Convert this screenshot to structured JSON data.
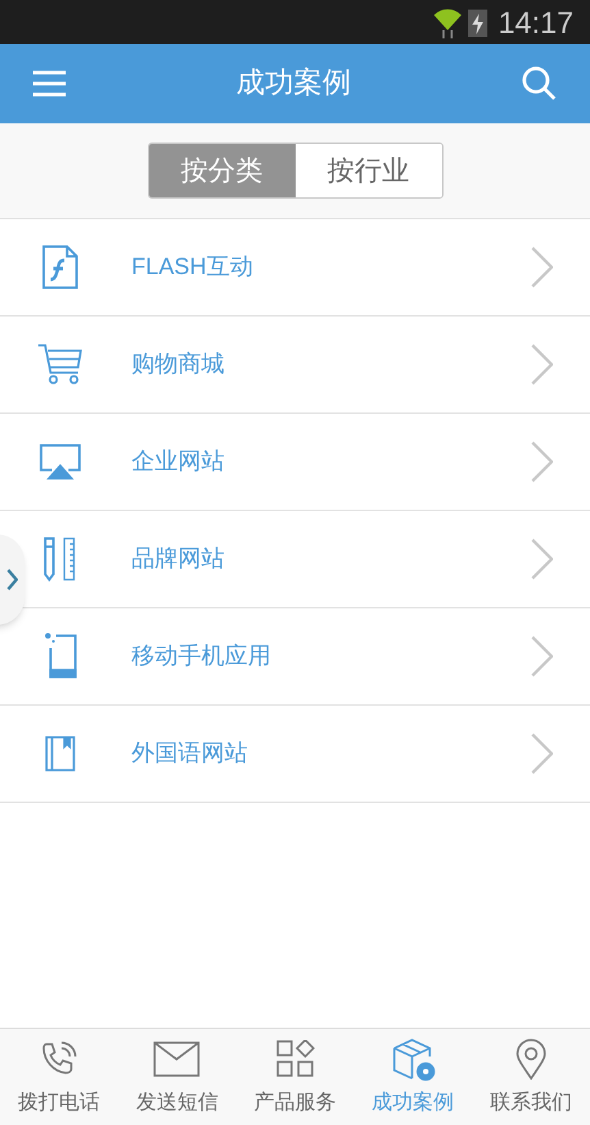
{
  "status_bar": {
    "time": "14:17"
  },
  "header": {
    "title": "成功案例"
  },
  "segments": [
    {
      "label": "按分类",
      "selected": true
    },
    {
      "label": "按行业",
      "selected": false
    }
  ],
  "categories": [
    {
      "label": "FLASH互动"
    },
    {
      "label": "购物商城"
    },
    {
      "label": "企业网站"
    },
    {
      "label": "品牌网站"
    },
    {
      "label": "移动手机应用"
    },
    {
      "label": "外国语网站"
    }
  ],
  "bottom_nav": [
    {
      "label": "拨打电话",
      "selected": false
    },
    {
      "label": "发送短信",
      "selected": false
    },
    {
      "label": "产品服务",
      "selected": false
    },
    {
      "label": "成功案例",
      "selected": true
    },
    {
      "label": "联系我们",
      "selected": false
    }
  ]
}
